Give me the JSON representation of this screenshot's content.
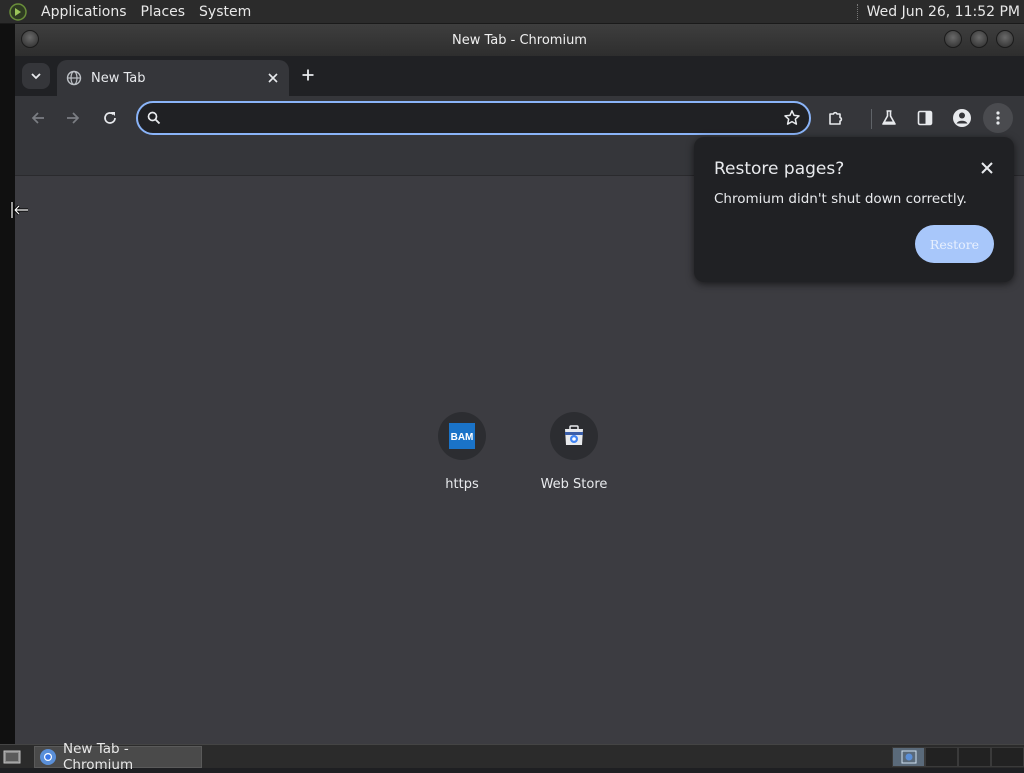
{
  "top_panel": {
    "menus": [
      "Applications",
      "Places",
      "System"
    ],
    "clock": "Wed Jun 26, 11:52 PM"
  },
  "window": {
    "title": "New Tab - Chromium"
  },
  "tabs": [
    {
      "label": "New Tab",
      "icon": "globe-icon"
    }
  ],
  "omnibox": {
    "value": "",
    "placeholder": ""
  },
  "shortcuts": [
    {
      "label": "https",
      "icon": "bam-icon",
      "icon_text": "BAM"
    },
    {
      "label": "Web Store",
      "icon": "web-store-icon"
    }
  ],
  "restore_bubble": {
    "title": "Restore pages?",
    "message": "Chromium didn't shut down correctly.",
    "button": "Restore"
  },
  "taskbar": {
    "task_label": "New Tab - Chromium"
  },
  "colors": {
    "accent": "#8ab4f8",
    "restore_button": "#a8c7fa",
    "content_bg": "#3c3c41"
  }
}
